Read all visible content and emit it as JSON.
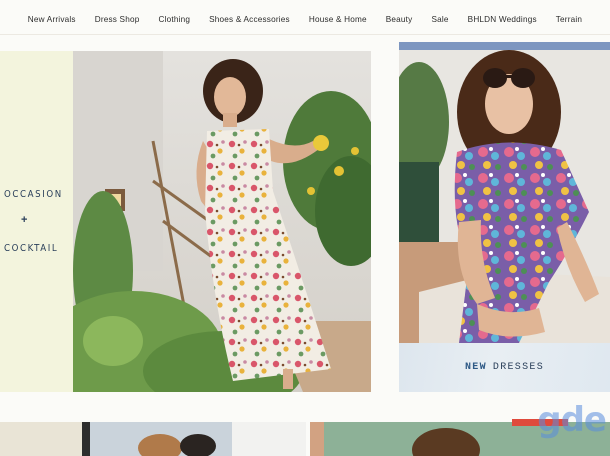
{
  "nav": {
    "items": [
      "New Arrivals",
      "Dress Shop",
      "Clothing",
      "Shoes & Accessories",
      "House & Home",
      "Beauty",
      "Sale",
      "BHLDN Weddings",
      "Terrain"
    ]
  },
  "left_panel": {
    "line1": "OCCASION",
    "separator": "+",
    "line2": "COCKTAIL"
  },
  "right_tile": {
    "caption_word1": "NEW",
    "caption_word2": "DRESSES"
  },
  "watermark": "gde",
  "colors": {
    "background": "#fbfbf8",
    "left_panel": "#f3f4dd",
    "caption_bg": "#e2eaf1",
    "accent_text": "#2a3f5a",
    "accent_blue": "#2f5a86"
  }
}
